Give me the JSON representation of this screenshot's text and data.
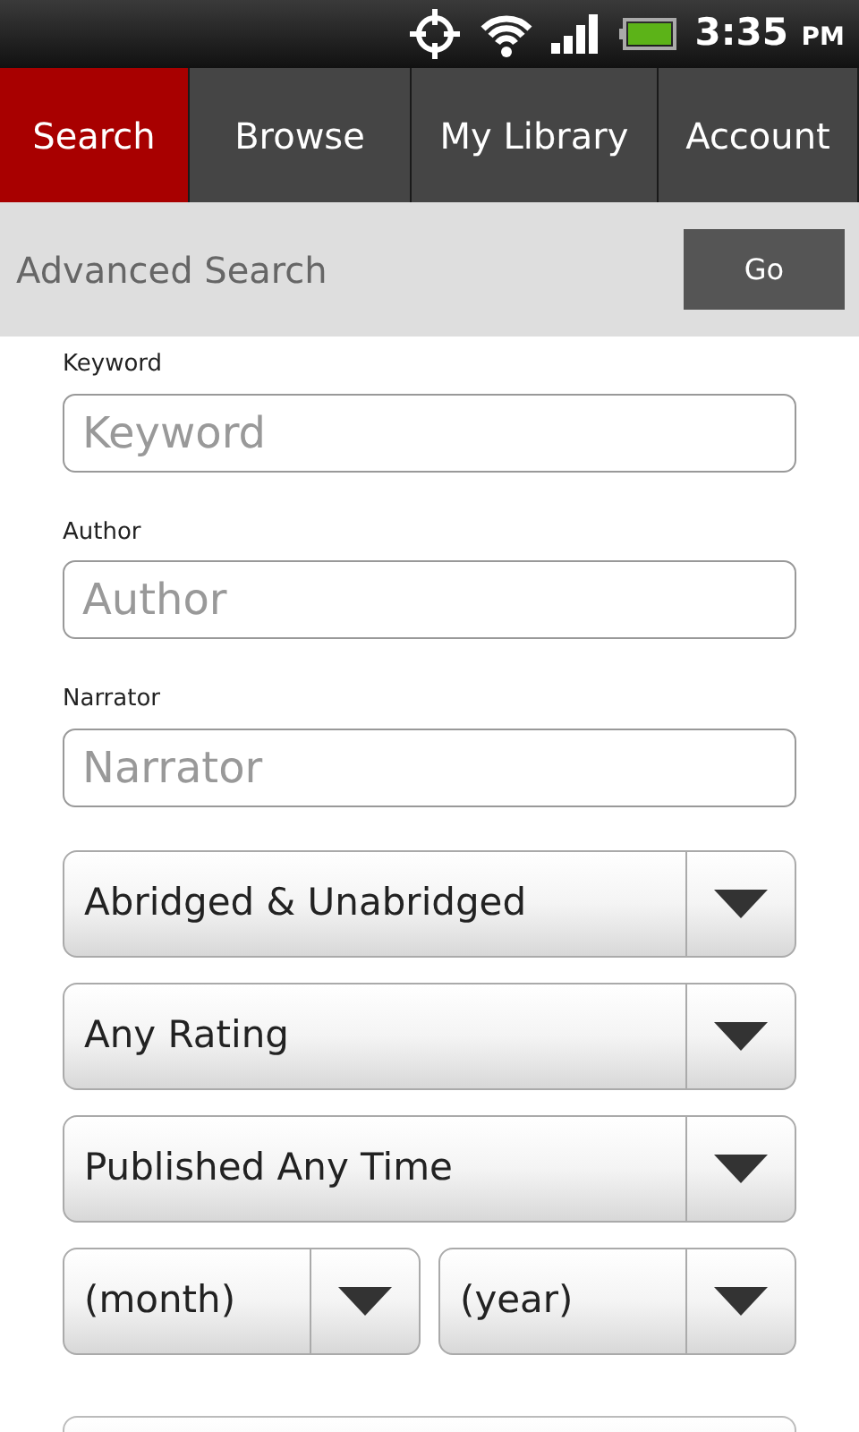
{
  "status_bar": {
    "time": "3:35",
    "ampm": "PM"
  },
  "tabs": [
    {
      "label": "Search",
      "selected": true
    },
    {
      "label": "Browse",
      "selected": false
    },
    {
      "label": "My Library",
      "selected": false
    },
    {
      "label": "Account",
      "selected": false
    }
  ],
  "header": {
    "title": "Advanced Search",
    "button": "Go"
  },
  "fields": [
    {
      "label": "Keyword",
      "placeholder": "Keyword"
    },
    {
      "label": "Author",
      "placeholder": "Author"
    },
    {
      "label": "Narrator",
      "placeholder": "Narrator"
    }
  ],
  "dropdowns": [
    {
      "value": "Abridged & Unabridged"
    },
    {
      "value": "Any Rating"
    },
    {
      "value": "Published Any Time"
    }
  ],
  "date_dropdowns": [
    {
      "value": "(month)"
    },
    {
      "value": "(year)"
    }
  ]
}
